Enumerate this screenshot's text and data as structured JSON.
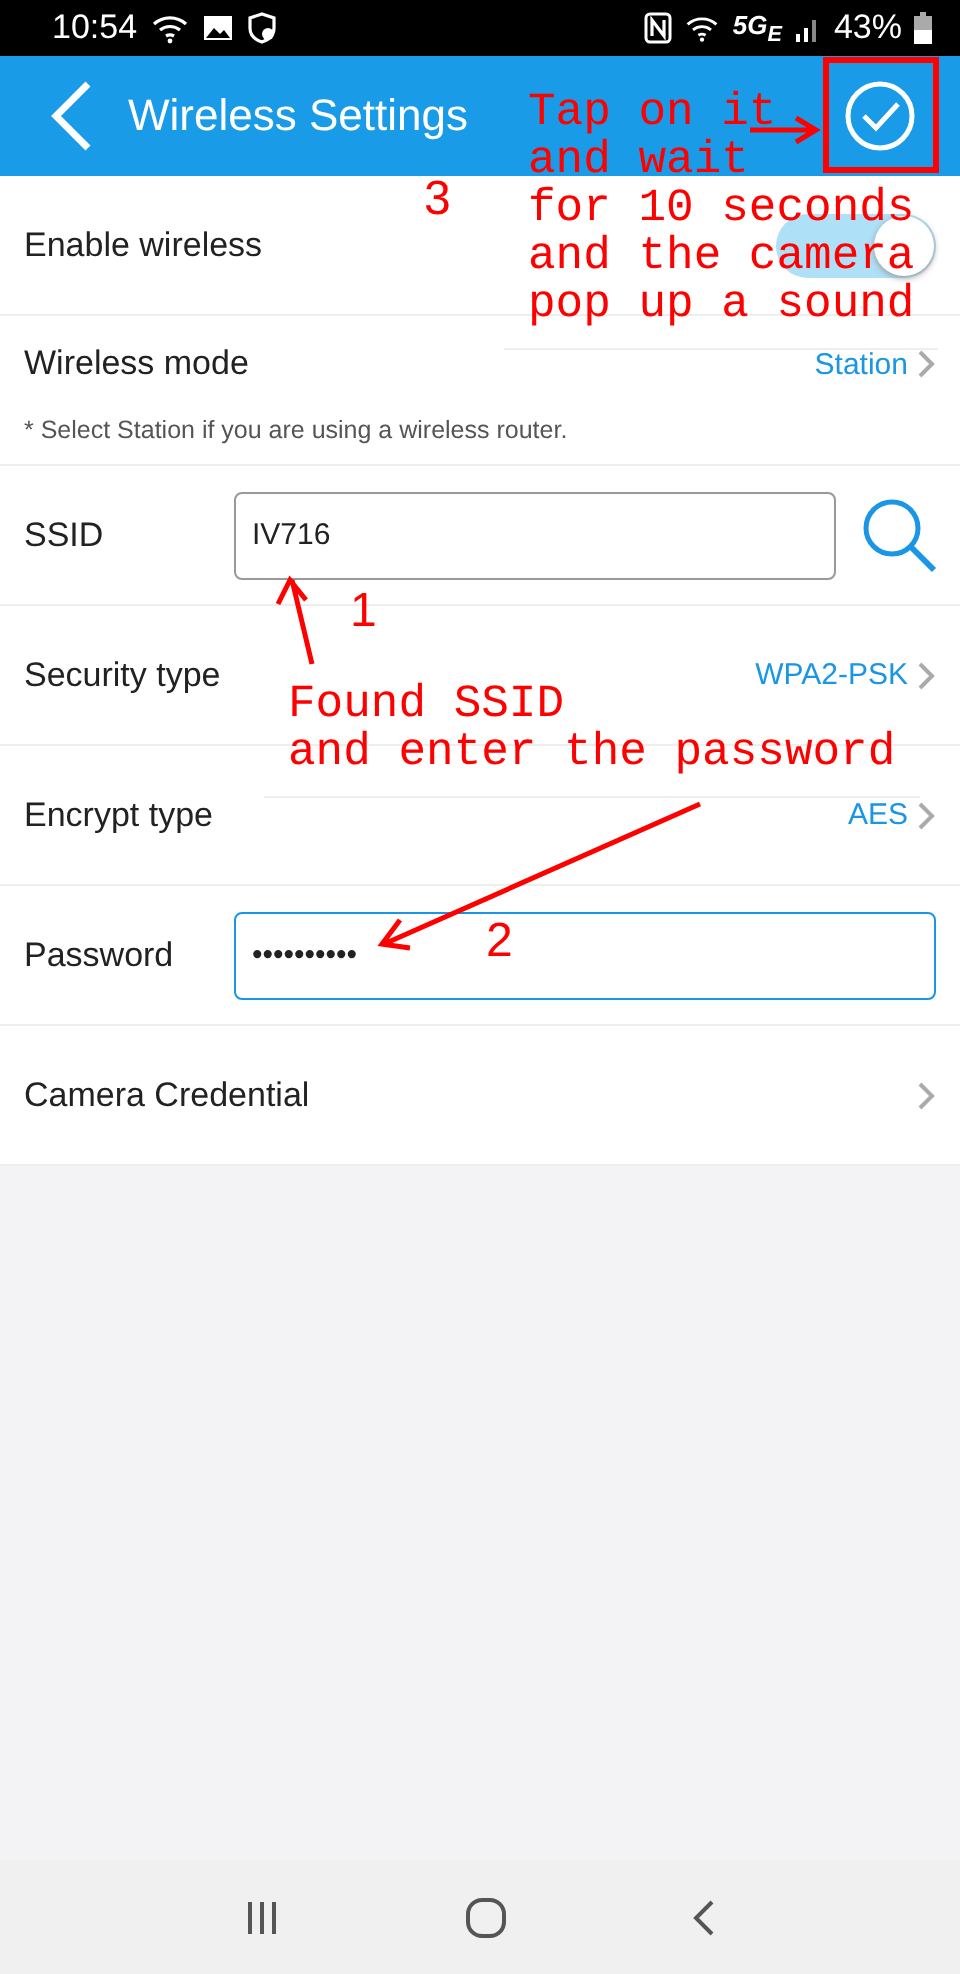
{
  "status_bar": {
    "time": "10:54",
    "network": "5G$_{E}$",
    "battery": "43%"
  },
  "header": {
    "title": "Wireless Settings"
  },
  "rows": [
    {
      "kind": "toggle",
      "label": "Enable wireless",
      "on": true
    },
    {
      "kind": "link",
      "label": "Wireless mode",
      "value": "Station",
      "note": "* Select Station if you are using a wireless router."
    },
    {
      "kind": "search",
      "label": "SSID",
      "value": "IV716",
      "focused": false
    },
    {
      "kind": "link",
      "label": "Security type",
      "value": "WPA2-PSK"
    },
    {
      "kind": "link",
      "label": "Encrypt type",
      "value": "AES"
    },
    {
      "kind": "field",
      "label": "Password",
      "value": "••••••••••",
      "focused": true
    },
    {
      "kind": "link",
      "label": "Camera Credential"
    }
  ],
  "annotations": [
    {
      "kind": "step",
      "text": "3"
    },
    {
      "kind": "note",
      "text": "Tap on it\nand wait\nfor 10 seconds\nand the camera\npop up a sound"
    },
    {
      "kind": "step",
      "text": "1"
    },
    {
      "kind": "note",
      "text": "Found SSID\nand enter the password"
    },
    {
      "kind": "step",
      "text": "2"
    }
  ]
}
